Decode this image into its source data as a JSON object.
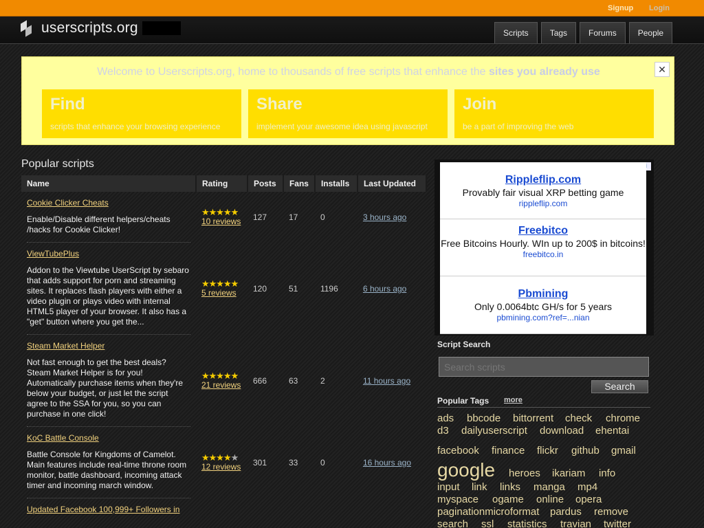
{
  "topbar": {
    "signup": "Signup",
    "login": "Login"
  },
  "brand": {
    "name": "userscripts.org"
  },
  "nav": [
    {
      "label": "Scripts"
    },
    {
      "label": "Tags"
    },
    {
      "label": "Forums"
    },
    {
      "label": "People"
    }
  ],
  "welcome": {
    "message_pre": "Welcome to Userscripts.org, home to thousands of free scripts that enhance the ",
    "message_em": "sites you already use",
    "close": "✕",
    "boxes": [
      {
        "title": "Find",
        "desc": "scripts that enhance your browsing experience"
      },
      {
        "title": "Share",
        "desc": "implement your awesome idea using javascript"
      },
      {
        "title": "Join",
        "desc": "be a part of improving the web"
      }
    ]
  },
  "popular": {
    "title": "Popular scripts",
    "columns": [
      "Name",
      "Rating",
      "Posts",
      "Fans",
      "Installs",
      "Last Updated"
    ],
    "rows": [
      {
        "name": "Cookie Clicker Cheats",
        "desc": "Enable/Disable different helpers/cheats /hacks for Cookie Clicker!",
        "rating": 5,
        "reviews": "10 reviews",
        "posts": "127",
        "fans": "17",
        "installs": "0",
        "updated": "3 hours ago"
      },
      {
        "name": "ViewTubePlus",
        "desc": "Addon to the Viewtube UserScript by sebaro that adds support for porn and streaming sites. It replaces flash players with either a video plugin or plays video with internal HTML5 player of your browser. It also has a \"get\" button where you get the...",
        "rating": 5,
        "reviews": "5 reviews",
        "posts": "120",
        "fans": "51",
        "installs": "1196",
        "updated": "6 hours ago"
      },
      {
        "name": "Steam Market Helper",
        "desc": "Not fast enough to get the best deals? Steam Market Helper is for you! Automatically purchase items when they're below your budget, or just let the script agree to the SSA for you, so you can purchase in one click!",
        "rating": 4.5,
        "reviews": "21 reviews",
        "posts": "666",
        "fans": "63",
        "installs": "2",
        "updated": "11 hours ago"
      },
      {
        "name": "KoC Battle Console",
        "desc": "Battle Console for Kingdoms of Camelot. Main features include real-time throne room monitor, battle dashboard, incoming attack timer and incoming march window.",
        "rating": 4,
        "reviews": "12 reviews",
        "posts": "301",
        "fans": "33",
        "installs": "0",
        "updated": "16 hours ago"
      },
      {
        "name": "Updated Facebook 100,999+ Followers in",
        "desc": "",
        "rating": 0,
        "reviews": "",
        "posts": "",
        "fans": "",
        "installs": "",
        "updated": ""
      }
    ]
  },
  "ads": [
    {
      "title": "Rippleflip.com",
      "text": "Provably fair visual XRP betting game",
      "url": "rippleflip.com"
    },
    {
      "title": "Freebitco",
      "text": "Free Bitcoins Hourly. WIn up to 200$ in bitcoins!",
      "url": "freebitco.in"
    },
    {
      "title": "Pbmining",
      "text": "Only 0.0064btc GH/s for 5 years",
      "url": "pbmining.com?ref=...nian"
    }
  ],
  "search": {
    "heading": "Script Search",
    "placeholder": "Search scripts",
    "button": "Search"
  },
  "tags": {
    "heading": "Popular Tags",
    "more": "more",
    "items": [
      "ads",
      "bbcode",
      "bittorrent",
      "check",
      "chrome",
      "d3",
      "dailyuserscript",
      "download",
      "ehentai",
      "facebook",
      "finance",
      "flickr",
      "github",
      "gmail",
      "google",
      "heroes",
      "ikariam",
      "info",
      "input",
      "link",
      "links",
      "manga",
      "mp4",
      "myspace",
      "ogame",
      "online",
      "opera",
      "paginationmicroformat",
      "pardus",
      "remove",
      "search",
      "ssl",
      "statistics",
      "travian",
      "twitter"
    ]
  }
}
